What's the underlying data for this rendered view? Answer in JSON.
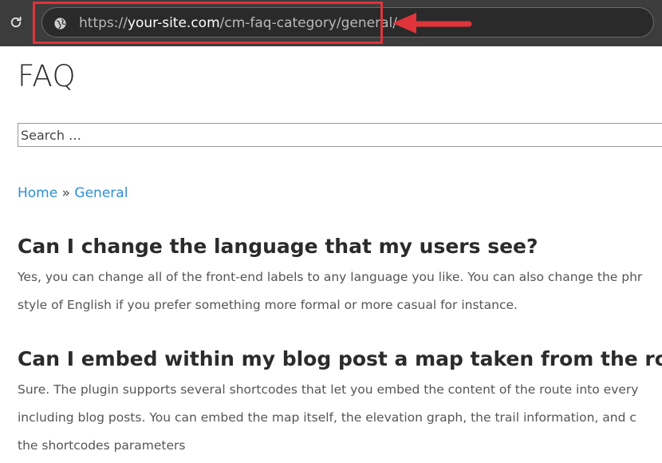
{
  "browser": {
    "url_scheme": "https://",
    "url_host": "your-site.com",
    "url_path": "/cm-faq-category/general/",
    "annotation_color": "#e0343b"
  },
  "page": {
    "title": "FAQ",
    "search": {
      "placeholder": "Search …"
    },
    "breadcrumb": {
      "home": "Home",
      "separator": "»",
      "current": "General"
    },
    "faqs": [
      {
        "question": "Can I change the language that my users see?",
        "answer_lines": [
          "Yes, you can change all of the front-end labels to any language you like. You can also change the phr",
          "style of English if you prefer something more formal or more casual for instance."
        ]
      },
      {
        "question": "Can I embed within my blog post a map taken from the rou",
        "answer_lines": [
          "Sure. The plugin supports several shortcodes that let you embed the content of the route into every",
          "including blog posts. You can embed the map itself, the elevation graph, the trail information, and c",
          "the shortcodes parameters"
        ]
      }
    ],
    "link_color": "#2d8fd5"
  }
}
